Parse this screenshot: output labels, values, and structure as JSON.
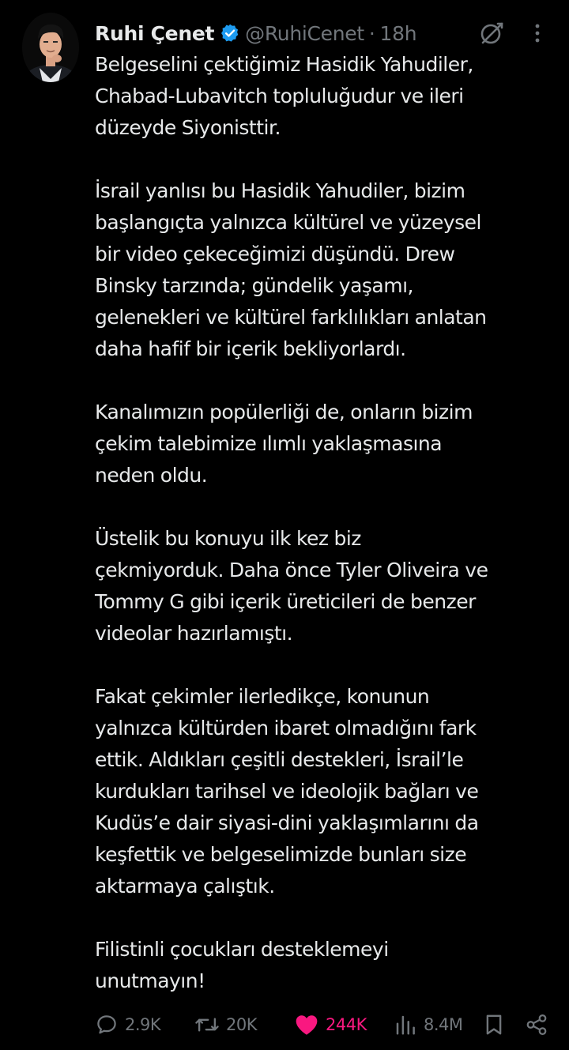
{
  "tweet": {
    "author": {
      "display_name": "Ruhi Çenet",
      "handle": "@RuhiCenet",
      "verified_icon": "verified-badge-icon"
    },
    "separator": "·",
    "time": "18h",
    "paragraphs": [
      [
        "Belgeselini çektiğimiz Hasidik Yahudiler,",
        "Chabad-Lubavitch topluluğudur ve ileri",
        "düzeyde Siyonisttir."
      ],
      [
        "İsrail yanlısı bu Hasidik Yahudiler, bizim",
        "başlangıçta yalnızca kültürel ve yüzeysel",
        "bir video çekeceğimizi düşündü. Drew",
        "Binsky tarzında; gündelik yaşamı,",
        "gelenekleri ve kültürel farklılıkları anlatan",
        "daha hafif bir içerik bekliyorlardı."
      ],
      [
        "Kanalımızın popülerliği de, onların bizim",
        "çekim talebimize ılımlı yaklaşmasına",
        "neden oldu."
      ],
      [
        "Üstelik bu konuyu ilk kez biz",
        "çekmiyorduk. Daha önce Tyler Oliveira ve",
        "Tommy G gibi içerik üreticileri de benzer",
        "videolar hazırlamıştı."
      ],
      [
        "Fakat çekimler ilerledikçe, konunun",
        "yalnızca kültürden ibaret olmadığını fark",
        "ettik. Aldıkları çeşitli destekleri, İsrail’le",
        "kurdukları tarihsel ve ideolojik bağları ve",
        "Kudüs’e dair siyasi-dini yaklaşımlarını da",
        "keşfettik ve belgeselimizde bunları size",
        "aktarmaya çalıştık."
      ],
      [
        "Filistinli çocukları desteklemeyi",
        "unutmayın!"
      ]
    ],
    "stats": {
      "replies": "2.9K",
      "reposts": "20K",
      "likes": "244K",
      "views": "8.4M"
    }
  },
  "icons": {
    "grok": "grok-icon",
    "more": "more-options-icon",
    "reply": "reply-icon",
    "repost": "repost-icon",
    "like": "heart-icon",
    "views": "views-chart-icon",
    "bookmark": "bookmark-icon",
    "share": "share-icon"
  },
  "colors": {
    "background": "#000000",
    "text": "#e7e9ea",
    "muted": "#71767b",
    "verified": "#1d9bf0",
    "like": "#f91880"
  }
}
